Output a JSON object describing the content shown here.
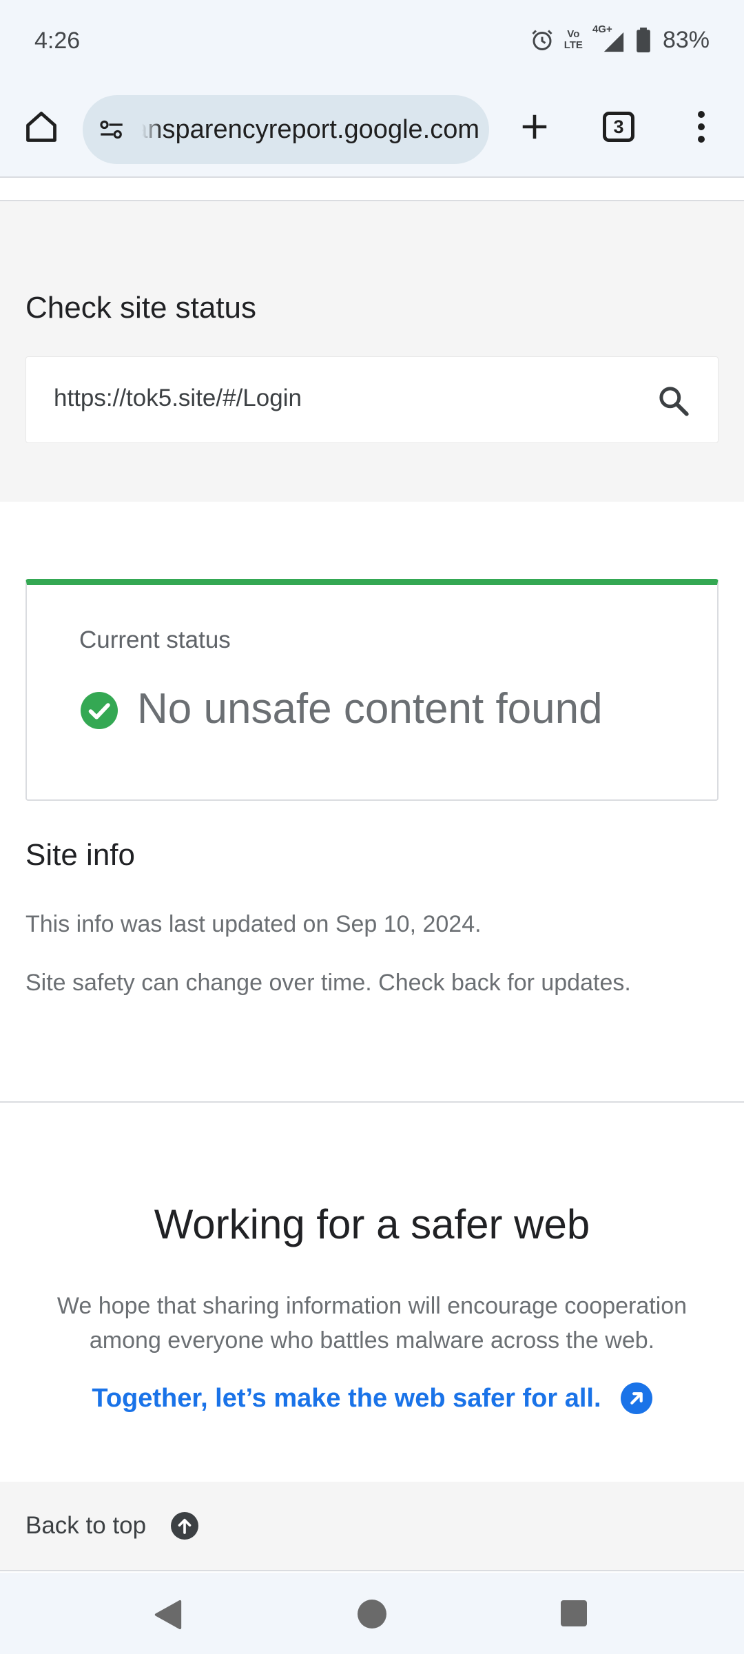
{
  "status_bar": {
    "time": "4:26",
    "volte_top": "Vo",
    "volte_bottom": "LTE",
    "network": "4G+",
    "battery": "83%"
  },
  "browser": {
    "url": "transparencyreport.google.com",
    "tab_count": "3"
  },
  "page": {
    "check_title": "Check site status",
    "search_value": "https://tok5.site/#/Login",
    "status_label": "Current status",
    "status_text": "No unsafe content found",
    "status_color": "#34a853",
    "siteinfo_title": "Site info",
    "siteinfo_line1": "This info was last updated on Sep 10, 2024.",
    "siteinfo_line2": "Site safety can change over time. Check back for updates.",
    "safer_title": "Working for a safer web",
    "safer_desc": "We hope that sharing information will encourage cooperation among everyone who battles malware across the web.",
    "safer_link": "Together, let’s make the web safer for all.",
    "link_color": "#1a73e8",
    "back_to_top": "Back to top"
  }
}
